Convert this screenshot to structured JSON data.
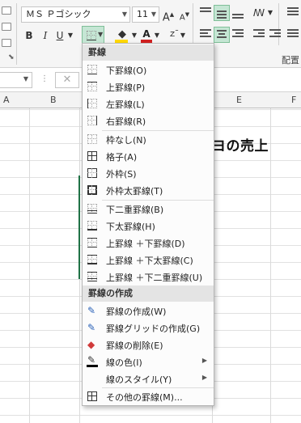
{
  "ribbon": {
    "font_name": "ＭＳ Ｐゴシック",
    "font_size": "11",
    "grow_font": "A",
    "shrink_font": "A",
    "bold": "B",
    "italic": "I",
    "underline": "U",
    "font_color_letter": "A",
    "group_label_alignment": "配置"
  },
  "formula_bar": {
    "cancel": "✕"
  },
  "columns": [
    "A",
    "B",
    "E",
    "F"
  ],
  "sheet": {
    "title_cell": "ヨの売上"
  },
  "menu": {
    "section1": "罫線",
    "items1": [
      {
        "label": "下罫線(O)",
        "icon": "border-bottom-icon"
      },
      {
        "label": "上罫線(P)",
        "icon": "border-top-icon"
      },
      {
        "label": "左罫線(L)",
        "icon": "border-left-icon"
      },
      {
        "label": "右罫線(R)",
        "icon": "border-right-icon"
      },
      {
        "label": "枠なし(N)",
        "icon": "border-none-icon"
      },
      {
        "label": "格子(A)",
        "icon": "border-all-icon"
      },
      {
        "label": "外枠(S)",
        "icon": "border-outside-icon"
      },
      {
        "label": "外枠太罫線(T)",
        "icon": "border-thick-outside-icon"
      },
      {
        "label": "下二重罫線(B)",
        "icon": "border-double-bottom-icon"
      },
      {
        "label": "下太罫線(H)",
        "icon": "border-thick-bottom-icon"
      },
      {
        "label": "上罫線 ＋下罫線(D)",
        "icon": "border-top-bottom-icon"
      },
      {
        "label": "上罫線 ＋下太罫線(C)",
        "icon": "border-top-thick-bottom-icon"
      },
      {
        "label": "上罫線 ＋下二重罫線(U)",
        "icon": "border-top-double-bottom-icon"
      }
    ],
    "section2": "罫線の作成",
    "items2": [
      {
        "label": "罫線の作成(W)",
        "icon": "draw-border-icon"
      },
      {
        "label": "罫線グリッドの作成(G)",
        "icon": "draw-border-grid-icon"
      },
      {
        "label": "罫線の削除(E)",
        "icon": "eraser-icon"
      },
      {
        "label": "線の色(I)",
        "icon": "line-color-icon"
      },
      {
        "label": "線のスタイル(Y)",
        "icon": "line-style-icon"
      },
      {
        "label": "その他の罫線(M)...",
        "icon": "more-borders-icon"
      }
    ]
  },
  "colors": {
    "accent_green": "#217346",
    "highlight_yellow": "#ffd800",
    "font_red": "#d02020"
  }
}
